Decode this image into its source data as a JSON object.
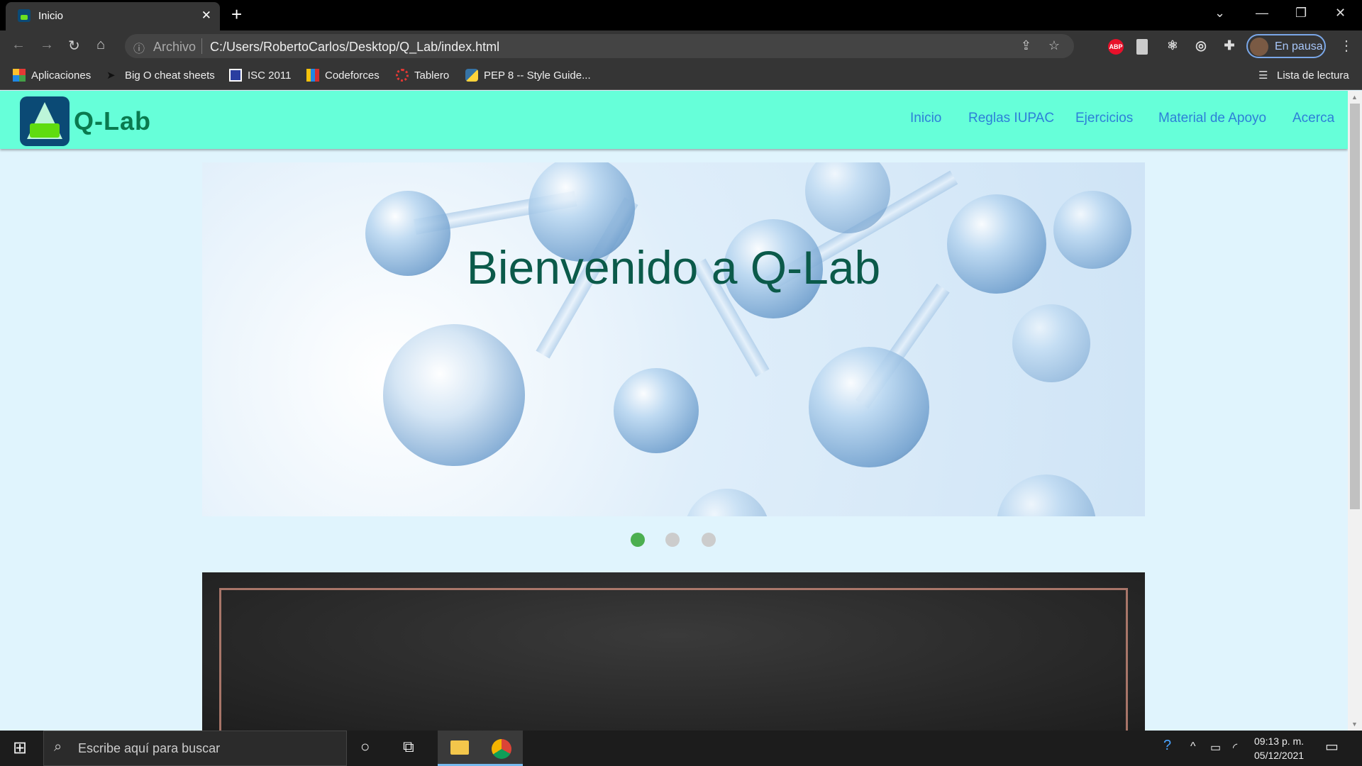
{
  "browser": {
    "tab_title": "Inicio",
    "address_prefix": "Archivo",
    "url": "C:/Users/RobertoCarlos/Desktop/Q_Lab/index.html",
    "profile_label": "En pausa",
    "bookmarks": [
      "Aplicaciones",
      "Big O cheat sheets",
      "ISC 2011",
      "Codeforces",
      "Tablero",
      "PEP 8 -- Style Guide..."
    ],
    "reading_list": "Lista de lectura",
    "extensions": {
      "abp": "ABP"
    }
  },
  "site": {
    "logo_text": "Q-Lab",
    "nav": [
      "Inicio",
      "Reglas IUPAC",
      "Ejercicios",
      "Material de Apoyo",
      "Acerca"
    ],
    "hero_title": "Bienvenido a Q-Lab",
    "carousel": {
      "slides": 3,
      "active": 1,
      "active_color": "#4caf50"
    }
  },
  "taskbar": {
    "search_placeholder": "Escribe aquí para buscar",
    "time": "09:13 p. m.",
    "date": "05/12/2021"
  }
}
